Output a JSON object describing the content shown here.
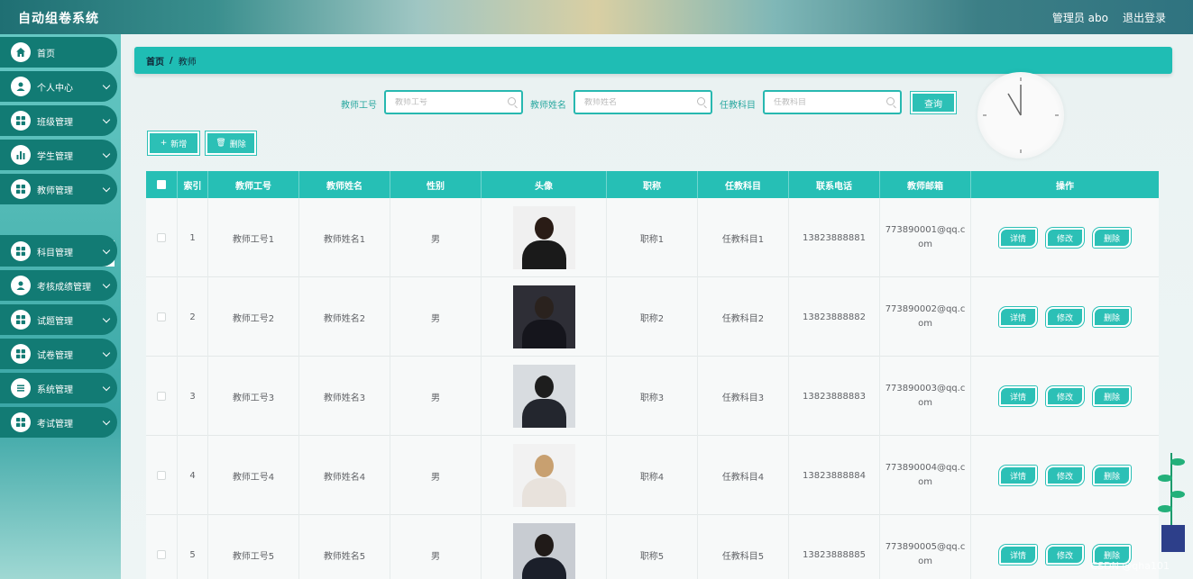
{
  "app": {
    "title": "自动组卷系统",
    "admin": "管理员 abo",
    "logout": "退出登录"
  },
  "sidebar": {
    "items": [
      {
        "label": "首页",
        "icon": "home-icon"
      },
      {
        "label": "个人中心",
        "icon": "user-icon"
      },
      {
        "label": "班级管理",
        "icon": "grid-icon"
      },
      {
        "label": "学生管理",
        "icon": "bar-chart-icon"
      },
      {
        "label": "教师管理",
        "icon": "grid-icon"
      },
      {
        "label": "科目管理",
        "icon": "grid-icon"
      },
      {
        "label": "考核成绩管理",
        "icon": "user-icon"
      },
      {
        "label": "试题管理",
        "icon": "grid-icon"
      },
      {
        "label": "试卷管理",
        "icon": "grid-icon"
      },
      {
        "label": "系统管理",
        "icon": "list-icon"
      },
      {
        "label": "考试管理",
        "icon": "grid-icon"
      }
    ],
    "active_sub": "教师"
  },
  "breadcrumb": {
    "home": "首页",
    "separator": "/",
    "current": "教师"
  },
  "search": {
    "id_label": "教师工号",
    "id_placeholder": "教师工号",
    "name_label": "教师姓名",
    "name_placeholder": "教师姓名",
    "subject_label": "任教科目",
    "subject_placeholder": "任教科目",
    "query": "查询"
  },
  "toolbar": {
    "add": "新增",
    "delete": "删除"
  },
  "table": {
    "columns": [
      "索引",
      "教师工号",
      "教师姓名",
      "性别",
      "头像",
      "职称",
      "任教科目",
      "联系电话",
      "教师邮箱",
      "操作"
    ],
    "actions": {
      "detail": "详情",
      "edit": "修改",
      "delete": "删除"
    },
    "rows": [
      {
        "index": "1",
        "id": "教师工号1",
        "name": "教师姓名1",
        "gender": "男",
        "title": "职称1",
        "subject": "任教科目1",
        "phone": "13823888881",
        "email1": "773890001@qq.c",
        "email2": "om"
      },
      {
        "index": "2",
        "id": "教师工号2",
        "name": "教师姓名2",
        "gender": "男",
        "title": "职称2",
        "subject": "任教科目2",
        "phone": "13823888882",
        "email1": "773890002@qq.c",
        "email2": "om"
      },
      {
        "index": "3",
        "id": "教师工号3",
        "name": "教师姓名3",
        "gender": "男",
        "title": "职称3",
        "subject": "任教科目3",
        "phone": "13823888883",
        "email1": "773890003@qq.c",
        "email2": "om"
      },
      {
        "index": "4",
        "id": "教师工号4",
        "name": "教师姓名4",
        "gender": "男",
        "title": "职称4",
        "subject": "任教科目4",
        "phone": "13823888884",
        "email1": "773890004@qq.c",
        "email2": "om"
      },
      {
        "index": "5",
        "id": "教师工号5",
        "name": "教师姓名5",
        "gender": "男",
        "title": "职称5",
        "subject": "任教科目5",
        "phone": "13823888885",
        "email1": "773890005@qq.c",
        "email2": "om"
      }
    ]
  },
  "watermark": "CSDN @qha101",
  "colors": {
    "accent": "#26bfb5",
    "sidebar_item": "#127b74"
  }
}
